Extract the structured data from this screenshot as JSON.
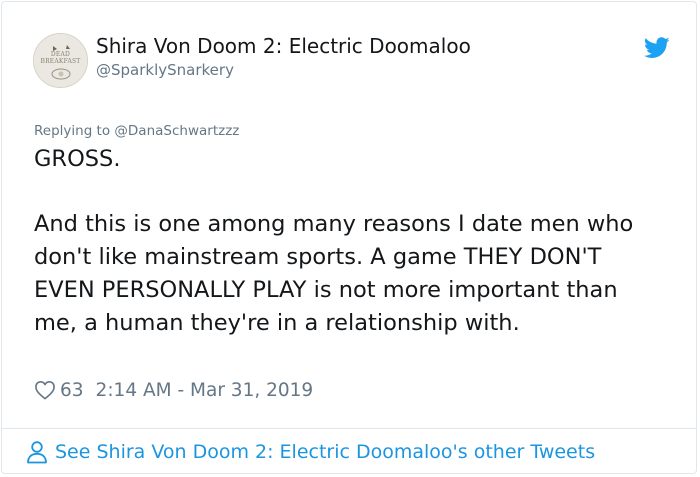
{
  "tweet": {
    "display_name": "Shira Von Doom 2: Electric Doomaloo",
    "handle": "@SparklySnarkery",
    "avatar_text": "DEAD BREAKFAST",
    "replying_prefix": "Replying to",
    "replying_to": "@DanaSchwartzzz",
    "text_line1": "GROSS.",
    "text_para2": "And this is one among many reasons I date men who don't like mainstream sports. A game THEY DON'T EVEN PERSONALLY PLAY is not more important than me, a human they're in a relationship with.",
    "likes": "63",
    "timestamp": "2:14 AM - Mar 31, 2019",
    "footer_link": "See Shira Von Doom 2: Electric Doomaloo's other Tweets"
  },
  "icons": {
    "brand": "twitter-bird-icon",
    "like": "heart-icon",
    "profile": "person-icon"
  },
  "colors": {
    "text": "#14171a",
    "muted": "#657786",
    "link": "#1b95e0",
    "twitter_blue": "#1da1f2",
    "border": "#e1e8ed"
  }
}
